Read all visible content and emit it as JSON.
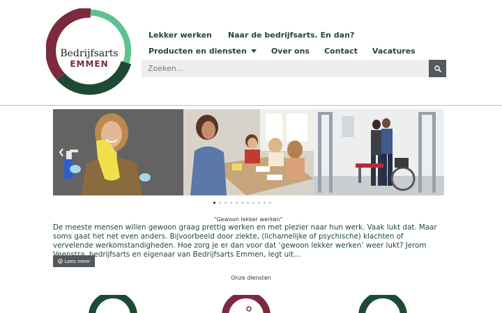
{
  "logo": {
    "line1": "Bedrijfsarts",
    "line2": "EMMEN",
    "colors": {
      "maroon": "#7b2a40",
      "light_green": "#5ec28f",
      "dark_green": "#1e4a35"
    }
  },
  "nav": {
    "top": [
      {
        "label": "Lekker werken"
      },
      {
        "label": "Naar de bedrijfsarts. En dan?"
      }
    ],
    "main": [
      {
        "label": "Producten en diensten",
        "has_dropdown": true
      },
      {
        "label": "Over ons"
      },
      {
        "label": "Contact"
      },
      {
        "label": "Vacatures"
      }
    ]
  },
  "search": {
    "placeholder": "Zoeken...",
    "button_icon": "search-icon"
  },
  "slider": {
    "slides": [
      {
        "icon": "photo-cleaning-woman"
      },
      {
        "icon": "photo-family-at-table"
      },
      {
        "icon": "photo-rehabilitation-gym"
      }
    ],
    "dot_count": 11,
    "active_dot": 1
  },
  "intro": {
    "heading": "\"Gewoon lekker werken\"",
    "text": "De meeste mensen willen gewoon graag prettig werken en met plezier naar hun werk. Vaak lukt dat. Maar soms gaat het net even anders. Bijvoorbeeld door ziekte, (lichamelijke of psychische) klachten of vervelende werkomstandigheden. Hoe zorg je er dan voor dat ‘gewoon lekker werken’ weer lukt? Jerom Veenstra, bedrijfsarts en eigenaar van Bedrijfsarts Emmen, legt uit…",
    "read_more": "Lees meer"
  },
  "services": {
    "heading": "Onze diensten"
  },
  "colors": {
    "nav_text": "#1e4a35",
    "button_gray": "#55595c",
    "input_bg": "#eeeeee"
  }
}
